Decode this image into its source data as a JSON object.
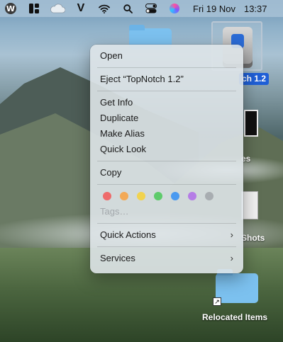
{
  "menubar": {
    "icons": [
      "wordpress-icon",
      "grid-layout-icon",
      "cloud-icon",
      "vivaldi-icon",
      "wifi-icon",
      "search-icon",
      "control-center-icon",
      "siri-icon"
    ],
    "vivaldi_glyph": "V",
    "wordpress_glyph": "W",
    "date": "Fri 19 Nov",
    "time": "13:37"
  },
  "desktop": {
    "disk_label": "ch 1.2",
    "side_label_1": "es",
    "side_label_2": "Shots",
    "relocated_label": "Relocated Items"
  },
  "context_menu": {
    "open": "Open",
    "eject": "Eject “TopNotch 1.2”",
    "get_info": "Get Info",
    "duplicate": "Duplicate",
    "make_alias": "Make Alias",
    "quick_look": "Quick Look",
    "copy": "Copy",
    "tag_colors": [
      "#ee6b6b",
      "#f2a957",
      "#f1d34f",
      "#5ecb6b",
      "#4a9af0",
      "#b57de6",
      "#a8adb1"
    ],
    "tags": "Tags…",
    "quick_actions": "Quick Actions",
    "services": "Services",
    "submenu_chevron": "›"
  }
}
